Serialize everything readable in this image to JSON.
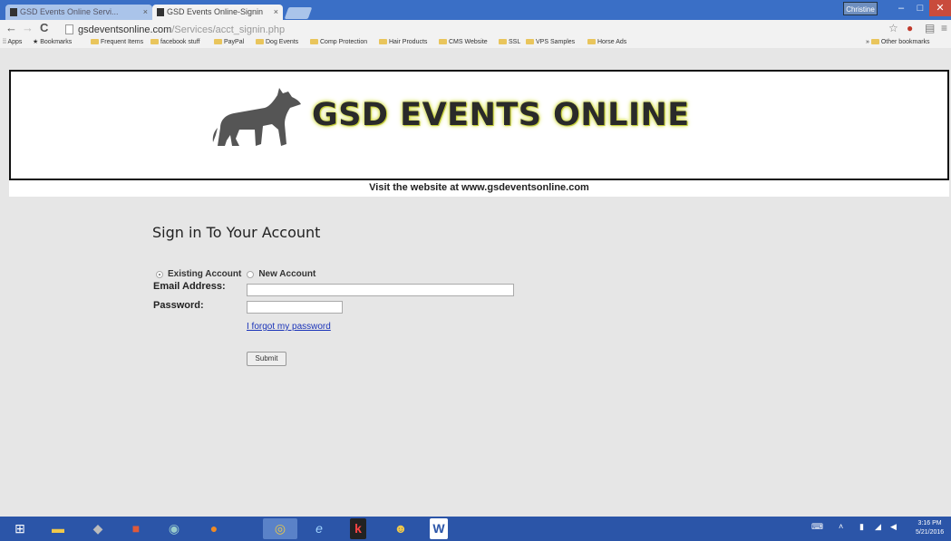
{
  "browser": {
    "tabs": [
      {
        "label": "GSD Events Online Servi..."
      },
      {
        "label": "GSD Events Online-Signin"
      }
    ],
    "user_button": "Christine",
    "address": {
      "domain": "gsdeventsonline.com",
      "path": "/Services/acct_signin.php"
    },
    "bookmarks": [
      {
        "label": "Apps"
      },
      {
        "label": "Bookmarks"
      },
      {
        "label": "Frequent Items"
      },
      {
        "label": "facebook stuff"
      },
      {
        "label": "PayPal"
      },
      {
        "label": "Dog Events"
      },
      {
        "label": "Comp Protection"
      },
      {
        "label": "Hair Products"
      },
      {
        "label": "CMS Website"
      },
      {
        "label": "SSL"
      },
      {
        "label": "VPS Samples"
      },
      {
        "label": "Horse Ads"
      },
      {
        "label": "Other bookmarks"
      }
    ]
  },
  "site": {
    "title": "GSD EVENTS ONLINE",
    "visit_text": "Visit the website at www.gsdeventsonline.com"
  },
  "signin": {
    "heading": "Sign in To Your Account",
    "radio_existing": "Existing Account",
    "radio_new": "New Account",
    "selected": "existing",
    "email_label": "Email Address:",
    "email_value": "",
    "password_label": "Password:",
    "password_value": "",
    "forgot_link": "I forgot my password",
    "submit_label": "Submit"
  },
  "taskbar": {
    "apps": [
      "start-icon",
      "file-explorer-icon",
      "app-icon",
      "app-icon",
      "app-icon",
      "firefox-icon",
      "chrome-icon",
      "internet-explorer-icon",
      "k-app-icon",
      "app-icon",
      "word-icon"
    ],
    "clock_time": "3:16 PM",
    "clock_date": "5/21/2016"
  },
  "colors": {
    "titlebar": "#3a6fc6",
    "taskbar": "#2b55a8",
    "page_bg": "#e6e6e6",
    "link": "#1a33b8"
  }
}
